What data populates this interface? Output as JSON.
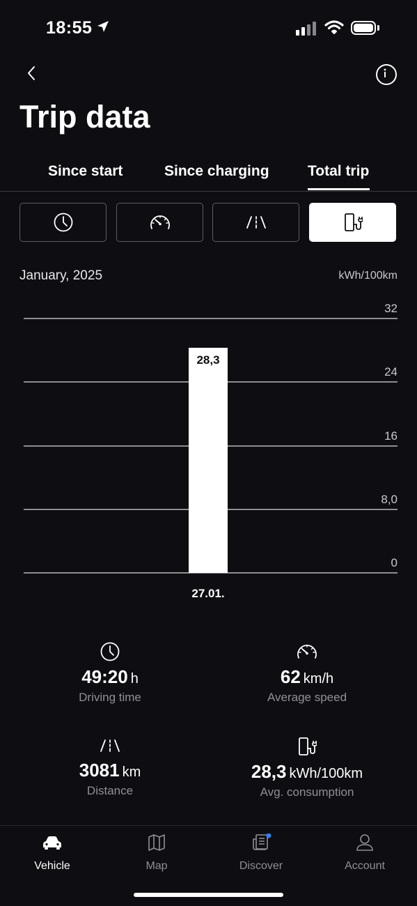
{
  "status_bar": {
    "time": "18:55"
  },
  "header": {
    "title": "Trip data"
  },
  "tabs": [
    {
      "label": "Since start",
      "active": false
    },
    {
      "label": "Since charging",
      "active": false
    },
    {
      "label": "Total trip",
      "active": true
    }
  ],
  "modes": [
    {
      "icon": "clock-icon",
      "active": false
    },
    {
      "icon": "speedometer-icon",
      "active": false
    },
    {
      "icon": "road-icon",
      "active": false
    },
    {
      "icon": "charging-station-icon",
      "active": true
    }
  ],
  "chart": {
    "month": "January, 2025",
    "unit": "kWh/100km"
  },
  "chart_data": {
    "type": "bar",
    "categories": [
      "27.01."
    ],
    "values": [
      28.3
    ],
    "value_labels": [
      "28,3"
    ],
    "ylim": [
      0,
      32
    ],
    "y_ticks": [
      "0",
      "8,0",
      "16",
      "24",
      "32"
    ],
    "y_tick_values": [
      0,
      8,
      16,
      24,
      32
    ],
    "ylabel": "kWh/100km",
    "grid": true
  },
  "stats": {
    "driving_time": {
      "value": "49:20",
      "unit": "h",
      "label": "Driving time"
    },
    "average_speed": {
      "value": "62",
      "unit": "km/h",
      "label": "Average speed"
    },
    "distance": {
      "value": "3081",
      "unit": "km",
      "label": "Distance"
    },
    "avg_consumption": {
      "value": "28,3",
      "unit": "kWh/100km",
      "label": "Avg. consumption"
    }
  },
  "bottom_nav": [
    {
      "label": "Vehicle",
      "icon": "car-icon",
      "active": true
    },
    {
      "label": "Map",
      "icon": "map-icon",
      "active": false
    },
    {
      "label": "Discover",
      "icon": "newspaper-icon",
      "active": false,
      "badge": true
    },
    {
      "label": "Account",
      "icon": "person-icon",
      "active": false
    }
  ],
  "colors": {
    "background": "#0e0e12",
    "accent": "#ffffff",
    "badge": "#2f7fff"
  }
}
